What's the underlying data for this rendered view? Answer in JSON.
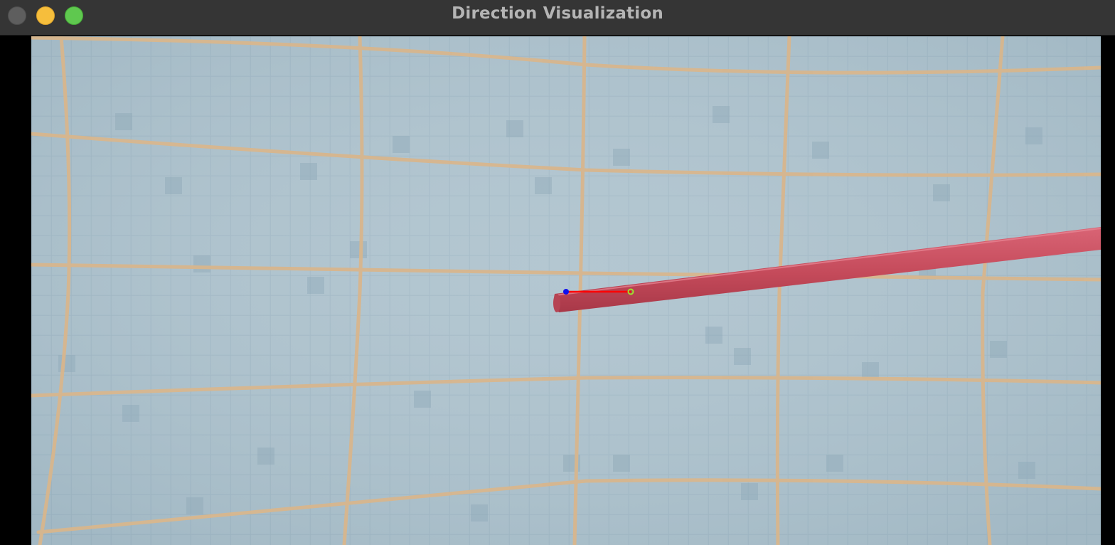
{
  "window": {
    "title": "Direction Visualization"
  },
  "traffic_lights": {
    "close_color": "#5e5e5e",
    "minimize_color": "#f6be3c",
    "maximize_color": "#5fc84f"
  },
  "scene": {
    "background_color": "#a9bfca",
    "grout_color": "#d8b68d",
    "tube_color": "#c44a5a"
  },
  "overlay": {
    "direction_line_color": "#ff0000",
    "start_point_color": "#1010ee",
    "end_point_color": "#9be22f"
  }
}
